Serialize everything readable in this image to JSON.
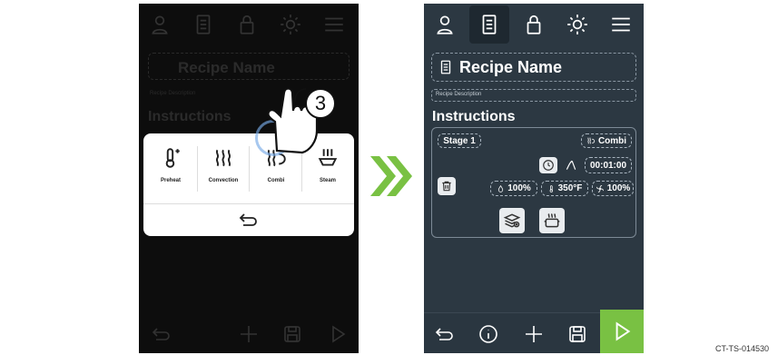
{
  "left_screen": {
    "recipe_name": "Recipe Name",
    "recipe_description": "Recipe Description",
    "instructions": "Instructions",
    "callout_number": "3",
    "modes": [
      {
        "label": "Preheat",
        "icon": "thermometer-icon"
      },
      {
        "label": "Convection",
        "icon": "heat-waves-icon"
      },
      {
        "label": "Combi",
        "icon": "combi-icon"
      },
      {
        "label": "Steam",
        "icon": "steam-icon"
      }
    ]
  },
  "right_screen": {
    "recipe_name": "Recipe Name",
    "recipe_description": "Recipe Description",
    "instructions": "Instructions",
    "stage_label": "Stage 1",
    "mode_label": "Combi",
    "time": "00:01:00",
    "humidity": "100%",
    "temperature": "350°F",
    "fan": "100%"
  },
  "caption": "CT-TS-014530",
  "colors": {
    "accent_green": "#79c143",
    "panel": "#2c3842"
  }
}
